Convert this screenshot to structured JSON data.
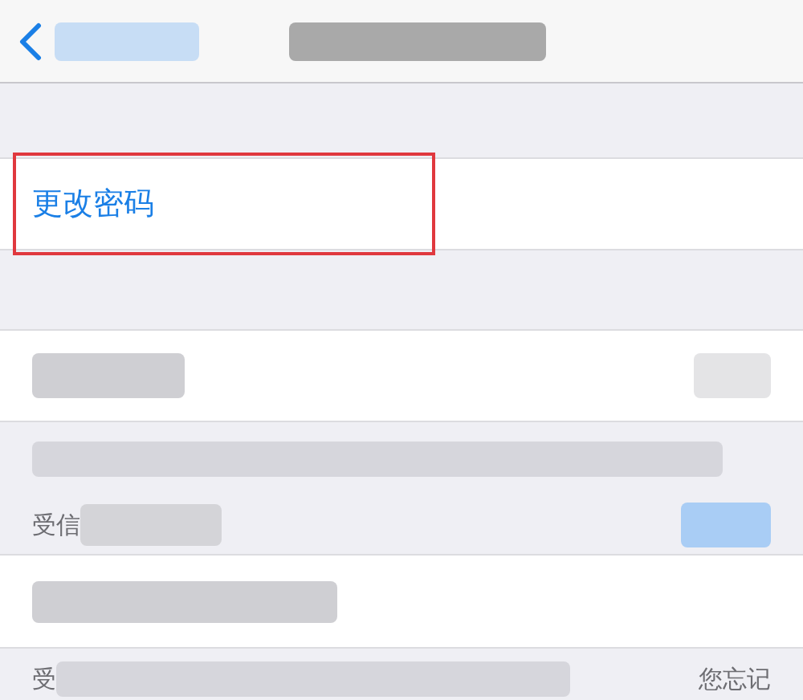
{
  "change_password": {
    "label": "更改密码",
    "highlighted": true
  },
  "trusted_footer": {
    "prefix": "受信"
  },
  "bottom_footer": {
    "prefix": "受",
    "suffix": "您忘记"
  }
}
